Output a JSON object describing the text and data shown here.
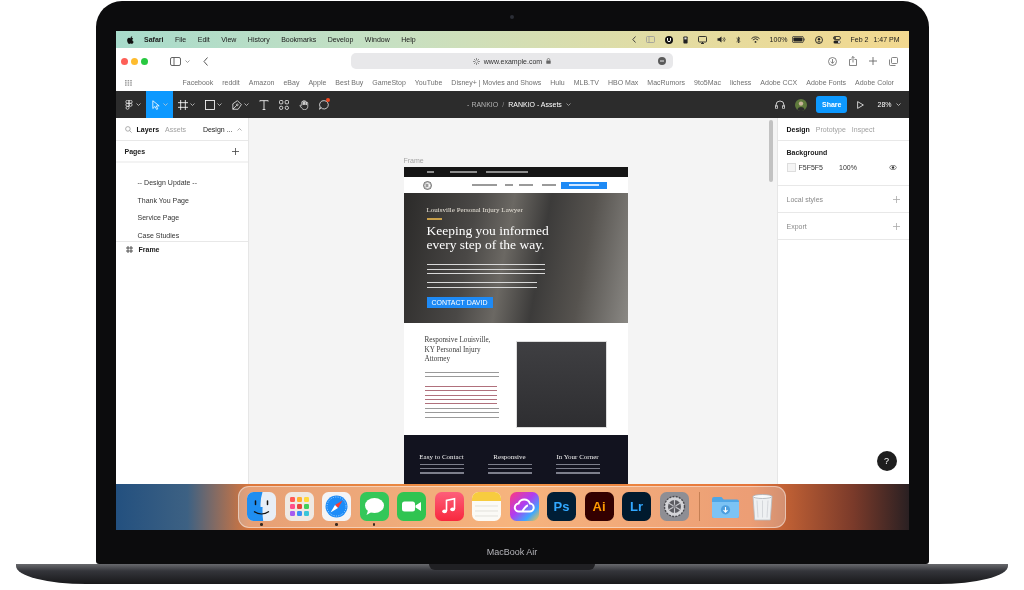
{
  "menu_bar": {
    "app": "Safari",
    "menus": [
      "File",
      "Edit",
      "View",
      "History",
      "Bookmarks",
      "Develop",
      "Window",
      "Help"
    ],
    "battery": "100%",
    "date": "Feb 2",
    "time": "1:47 PM"
  },
  "browser": {
    "url": "www.example.com",
    "bookmarks": [
      "Facebook",
      "reddit",
      "Amazon",
      "eBay",
      "Apple",
      "Best Buy",
      "GameStop",
      "YouTube",
      "Disney+ | Movies and Shows",
      "Hulu",
      "MLB.TV",
      "HBO Max",
      "MacRumors",
      "9to5Mac",
      "lichess",
      "Adobe CCX",
      "Adobe Fonts",
      "Adobe Color"
    ]
  },
  "figma": {
    "tools": [
      {
        "kind": "main-menu",
        "selected": false,
        "notification": false
      },
      {
        "kind": "move",
        "selected": true,
        "notification": false
      },
      {
        "kind": "frame",
        "selected": false,
        "notification": false
      },
      {
        "kind": "shape",
        "selected": false,
        "notification": false
      },
      {
        "kind": "pen",
        "selected": false,
        "notification": false
      },
      {
        "kind": "text",
        "selected": false,
        "notification": false
      },
      {
        "kind": "resources",
        "selected": false,
        "notification": false
      },
      {
        "kind": "hand",
        "selected": false,
        "notification": false
      },
      {
        "kind": "comment",
        "selected": false,
        "notification": true
      }
    ],
    "breadcrumb": {
      "project": "- RANKIO",
      "separator": "/",
      "file": "RANKIO - Assets"
    },
    "share": "Share",
    "zoom": "28%",
    "left_panel": {
      "tabs": [
        {
          "label": "Layers",
          "selected": true
        },
        {
          "label": "Assets",
          "selected": false
        }
      ],
      "page_menu": "Design ...",
      "pages_heading": "Pages",
      "pages": [
        {
          "label": "-- Design Update --",
          "selected": false
        },
        {
          "label": "Thank You Page",
          "selected": false
        },
        {
          "label": "Service Page",
          "selected": false
        },
        {
          "label": "Case Studies",
          "selected": false
        }
      ],
      "layers": [
        {
          "kind": "frame",
          "label": "Frame"
        }
      ]
    },
    "canvas": {
      "frame_label": "Frame"
    },
    "right_panel": {
      "tabs": [
        {
          "label": "Design",
          "selected": true
        },
        {
          "label": "Prototype",
          "selected": false
        },
        {
          "label": "Inspect",
          "selected": false
        }
      ],
      "background": {
        "heading": "Background",
        "hex": "F5F5F5",
        "opacity": "100%"
      },
      "sections": [
        "Local styles",
        "Export"
      ]
    },
    "help": "?"
  },
  "website": {
    "hero": {
      "eyebrow": "Louisville Personal Injury Lawyer",
      "headline": "Keeping you informed every step of the way.",
      "button": "CONTACT DAVID"
    },
    "intro": {
      "heading": "Responsive Louisville, KY Personal Injury Attorney"
    },
    "features": [
      "Easy to Contact",
      "Responsive",
      "In Your Corner"
    ]
  },
  "dock": {
    "apps": [
      {
        "kind": "finder",
        "running": true
      },
      {
        "kind": "launchpad",
        "running": false
      },
      {
        "kind": "safari",
        "running": true
      },
      {
        "kind": "messages",
        "running": true
      },
      {
        "kind": "facetime",
        "running": false
      },
      {
        "kind": "music",
        "running": false
      },
      {
        "kind": "notes",
        "running": false
      },
      {
        "kind": "creative-cloud",
        "running": false
      },
      {
        "kind": "photoshop",
        "label": "Ps",
        "running": false
      },
      {
        "kind": "illustrator",
        "label": "Ai",
        "running": false
      },
      {
        "kind": "lightroom",
        "label": "Lr",
        "running": false
      },
      {
        "kind": "settings",
        "running": false
      }
    ],
    "stacks": [
      {
        "kind": "downloads"
      },
      {
        "kind": "trash"
      }
    ]
  },
  "laptop": {
    "model": "MacBook Air"
  }
}
